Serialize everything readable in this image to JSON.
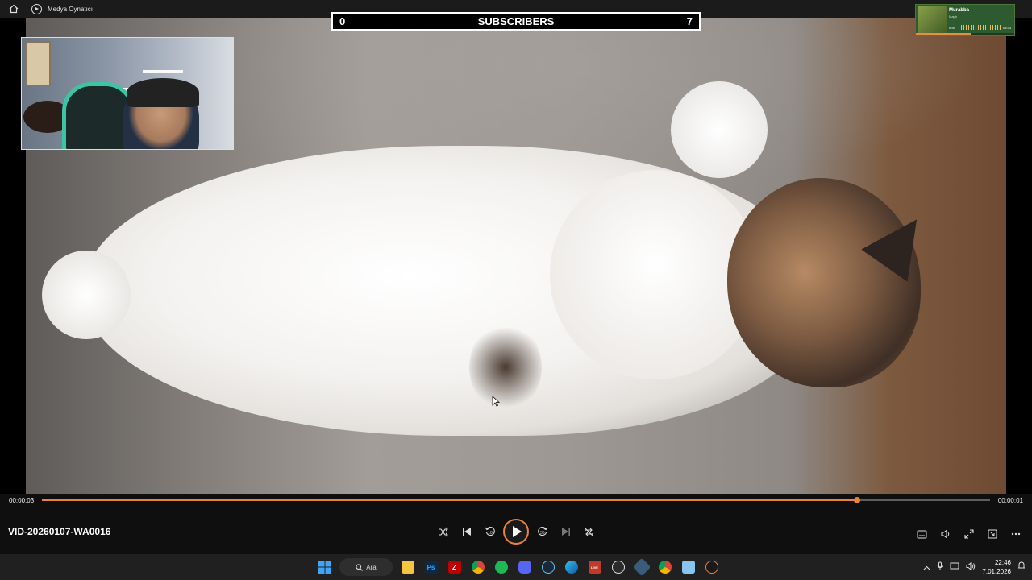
{
  "window": {
    "title": "Medya Oynatıcı"
  },
  "overlay": {
    "subs_left": "0",
    "subs_label": "SUBSCRIBERS",
    "subs_right": "7"
  },
  "music_widget": {
    "track": "Murabba",
    "artist": "Magh",
    "time_elapsed": "0:55",
    "time_total": "03:33",
    "progress": 0.55
  },
  "player": {
    "filename": "VID-20260107-WA0016",
    "time_elapsed": "00:00:03",
    "time_remaining": "00:00:01",
    "progress": 0.86,
    "accent": "#e8823c",
    "controls": [
      "shuffle-icon",
      "previous-icon",
      "rewind-10-icon",
      "play-icon",
      "forward-30-icon",
      "next-icon",
      "repeat-off-icon"
    ],
    "right_controls": [
      "subtitles-icon",
      "volume-icon",
      "fullscreen-icon",
      "mini-player-icon",
      "more-icon"
    ]
  },
  "taskbar": {
    "search_label": "Ara",
    "time": "22:46",
    "date": "7.01.2026"
  }
}
